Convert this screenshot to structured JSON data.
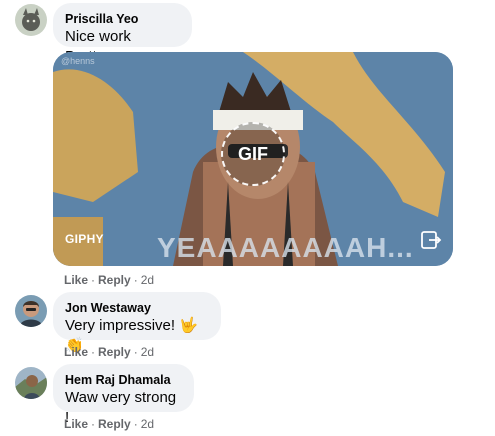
{
  "comments": [
    {
      "author": "Priscilla Yeo",
      "text": "Nice work Brettus",
      "avatar": "avatar-cat",
      "has_gif": true,
      "gif": {
        "credit": "@henns",
        "provider": "GIPHY",
        "badge": "GIF",
        "caption": "YEAAAAAAAAH..."
      },
      "actions": {
        "like": "Like",
        "reply": "Reply",
        "time": "2d"
      }
    },
    {
      "author": "Jon Westaway",
      "text": "Very impressive! 🤟👏",
      "avatar": "avatar-man",
      "actions": {
        "like": "Like",
        "reply": "Reply",
        "time": "2d"
      }
    },
    {
      "author": "Hem Raj Dhamala",
      "text": "Waw very strong !",
      "avatar": "avatar-outdoor",
      "actions": {
        "like": "Like",
        "reply": "Reply",
        "time": "2d"
      }
    }
  ],
  "colors": {
    "bubble": "#f0f2f5",
    "meta": "#65676b",
    "text": "#050505"
  }
}
